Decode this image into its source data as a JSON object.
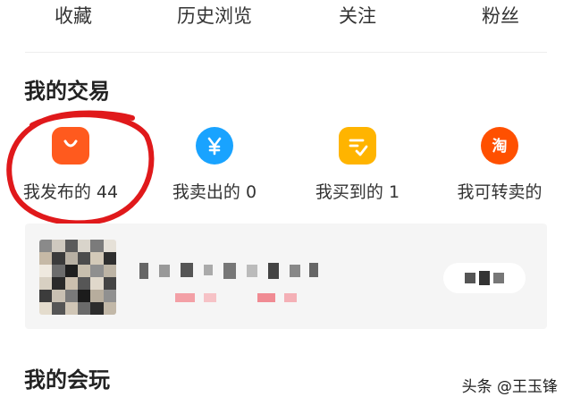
{
  "stats": [
    {
      "label": "收藏"
    },
    {
      "label": "历史浏览"
    },
    {
      "label": "关注"
    },
    {
      "label": "粉丝"
    }
  ],
  "trade": {
    "title": "我的交易",
    "items": [
      {
        "label": "我发布的 44",
        "icon": "shopping-bag-icon",
        "color": "#ff5a1e"
      },
      {
        "label": "我卖出的 0",
        "icon": "yen-icon",
        "color": "#19a3ff"
      },
      {
        "label": "我买到的 1",
        "icon": "checklist-icon",
        "color": "#ffb400"
      },
      {
        "label": "我可转卖的",
        "icon": "taobao-icon",
        "color": "#ff5000"
      }
    ]
  },
  "play": {
    "title": "我的会玩"
  },
  "watermark": "头条 @王玉锋",
  "colors": {
    "annotation": "#e0191b",
    "card_bg": "#f5f5f5"
  }
}
